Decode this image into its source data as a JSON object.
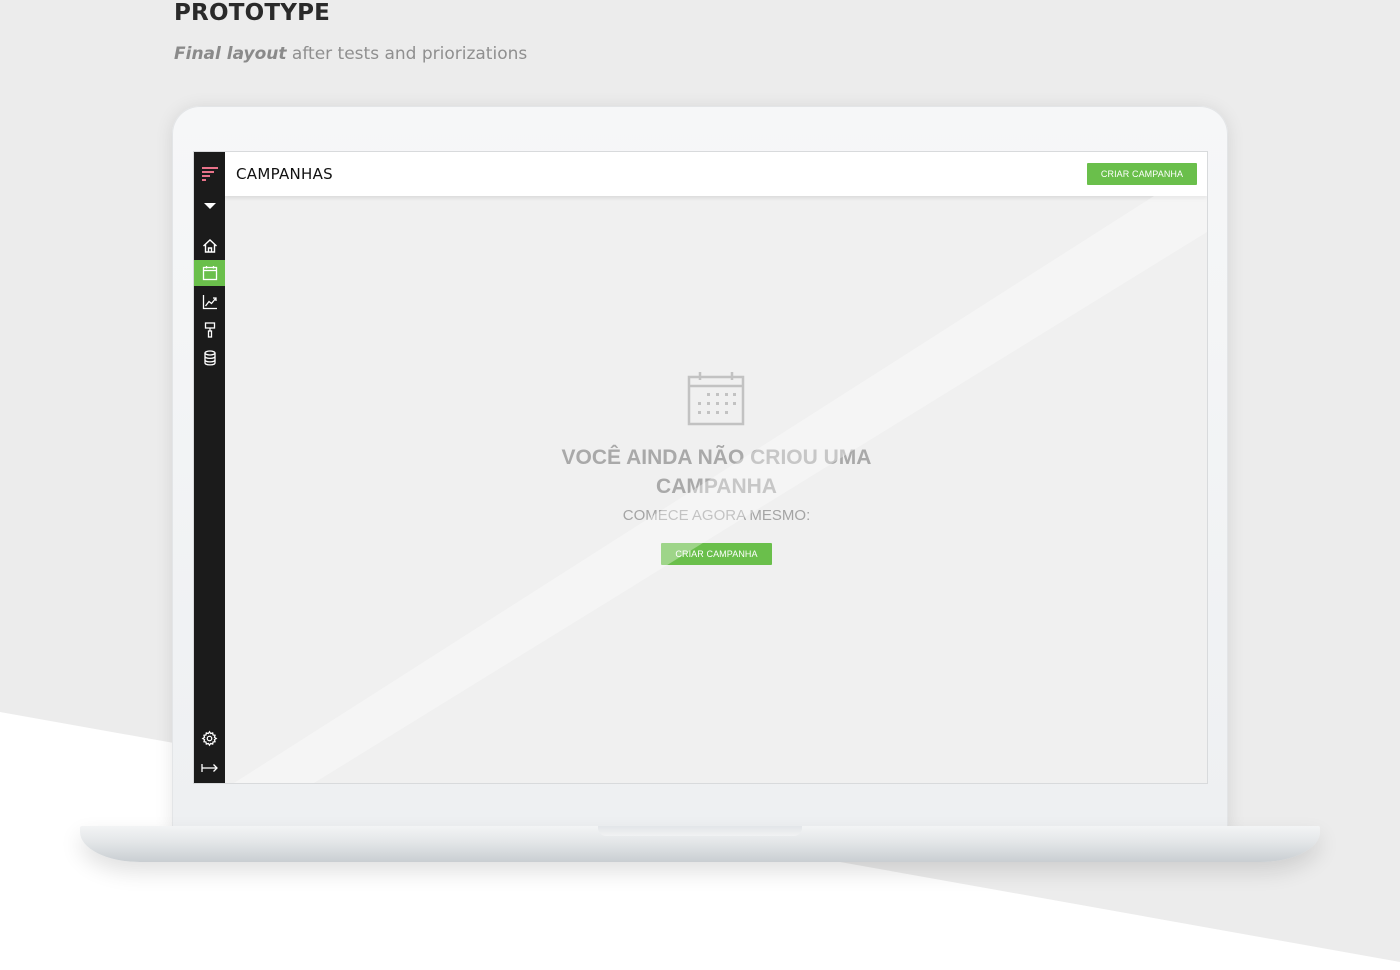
{
  "header": {
    "title": "PROTOTYPE",
    "subtitle_emphasis": "Final layout",
    "subtitle_rest": " after tests and priorizations"
  },
  "app": {
    "page_title": "CAMPANHAS",
    "create_button_label": "CRIAR CAMPANHA",
    "sidebar": {
      "items": [
        {
          "icon": "logo-icon"
        },
        {
          "icon": "dropdown-caret-icon"
        },
        {
          "icon": "home-icon"
        },
        {
          "icon": "calendar-icon",
          "active": true
        },
        {
          "icon": "chart-line-icon"
        },
        {
          "icon": "paint-roller-icon"
        },
        {
          "icon": "database-icon"
        },
        {
          "icon": "gear-icon"
        },
        {
          "icon": "logout-arrow-icon"
        }
      ]
    },
    "empty_state": {
      "title": "VOCÊ AINDA NÃO CRIOU UMA CAMPANHA",
      "subtitle": "COMECE AGORA MESMO:",
      "button_label": "CRIAR CAMPANHA",
      "icon": "calendar-icon"
    }
  },
  "colors": {
    "accent": "#6abf4b",
    "sidebar": "#1b1b1b",
    "logo": "#e9738a"
  }
}
